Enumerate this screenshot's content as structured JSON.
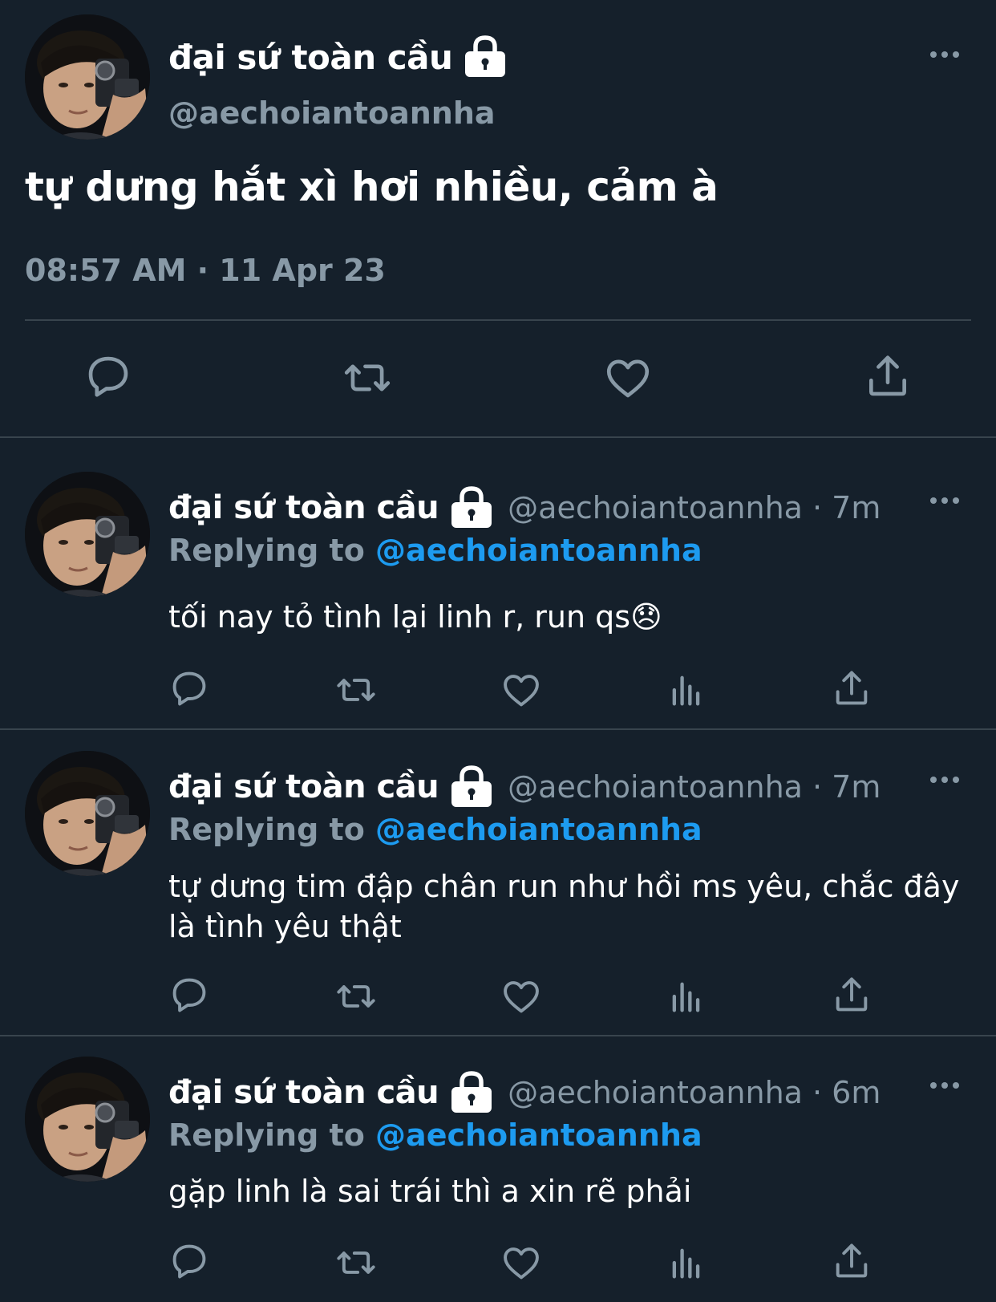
{
  "colors": {
    "background": "#15202b",
    "secondary_text": "#8899a6",
    "accent": "#1d9bf0",
    "divider": "#38444d"
  },
  "main_tweet": {
    "display_name": "đại sứ toàn cầu",
    "handle": "@aechoiantoannha",
    "text": "tự dưng hắt xì hơi nhiều, cảm à",
    "timestamp": "08:57 AM · 11 Apr 23",
    "icons": [
      "lock-icon",
      "more-icon",
      "reply-icon",
      "retweet-icon",
      "like-icon",
      "share-icon"
    ]
  },
  "replies": [
    {
      "display_name": "đại sứ toàn cầu",
      "handle_time": "@aechoiantoannha · 7m",
      "replying_label": "Replying to",
      "replying_to": "@aechoiantoannha",
      "text": "tối nay tỏ tình lại linh r, run qs😞"
    },
    {
      "display_name": "đại sứ toàn cầu",
      "handle_time": "@aechoiantoannha · 7m",
      "replying_label": "Replying to",
      "replying_to": "@aechoiantoannha",
      "text": "tự dưng tim đập chân run như hồi ms yêu, chắc đây là tình yêu thật"
    },
    {
      "display_name": "đại sứ toàn cầu",
      "handle_time": "@aechoiantoannha · 6m",
      "replying_label": "Replying to",
      "replying_to": "@aechoiantoannha",
      "text": "gặp linh là sai trái thì a xin rẽ phải"
    }
  ]
}
